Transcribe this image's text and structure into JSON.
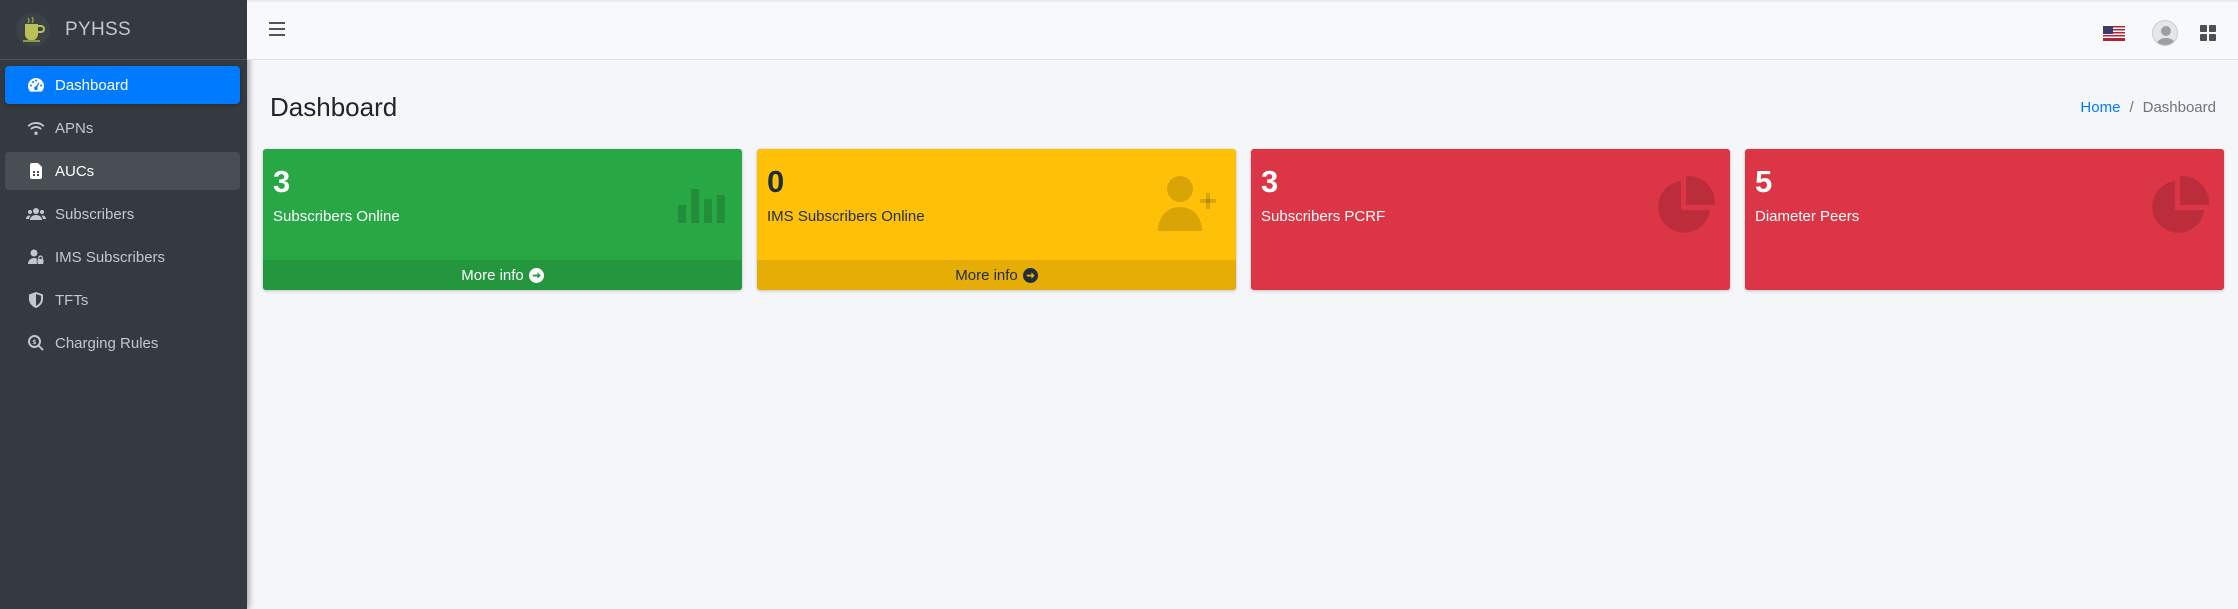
{
  "brand": {
    "name": "PYHSS",
    "logo_icon": "cup-logo-icon"
  },
  "sidebar": {
    "items": [
      {
        "label": "Dashboard",
        "icon": "tachometer-icon",
        "state": "active"
      },
      {
        "label": "APNs",
        "icon": "wifi-icon",
        "state": "normal"
      },
      {
        "label": "AUCs",
        "icon": "sim-card-icon",
        "state": "hover"
      },
      {
        "label": "Subscribers",
        "icon": "users-icon",
        "state": "normal"
      },
      {
        "label": "IMS Subscribers",
        "icon": "user-lock-icon",
        "state": "normal"
      },
      {
        "label": "TFTs",
        "icon": "shield-icon",
        "state": "normal"
      },
      {
        "label": "Charging Rules",
        "icon": "search-dollar-icon",
        "state": "normal"
      }
    ]
  },
  "topbar": {
    "menu_icon": "hamburger-icon",
    "language_icon": "us-flag-icon",
    "user_icon": "avatar-icon",
    "apps_icon": "grid-icon"
  },
  "header": {
    "title": "Dashboard",
    "breadcrumb": {
      "home": "Home",
      "separator": "/",
      "current": "Dashboard"
    }
  },
  "boxes": [
    {
      "value": "3",
      "label": "Subscribers Online",
      "footer": "More info",
      "color": "#28a745",
      "icon": "bar-chart-icon"
    },
    {
      "value": "0",
      "label": "IMS Subscribers Online",
      "footer": "More info",
      "color": "#ffc107",
      "icon": "user-plus-icon"
    },
    {
      "value": "3",
      "label": "Subscribers PCRF",
      "footer": "",
      "color": "#dc3545",
      "icon": "pie-chart-icon"
    },
    {
      "value": "5",
      "label": "Diameter Peers",
      "footer": "",
      "color": "#dc3545",
      "icon": "pie-chart-icon"
    }
  ],
  "colors": {
    "sidebar_bg": "#343a40",
    "active": "#007bff",
    "content_bg": "#f4f6f9"
  }
}
